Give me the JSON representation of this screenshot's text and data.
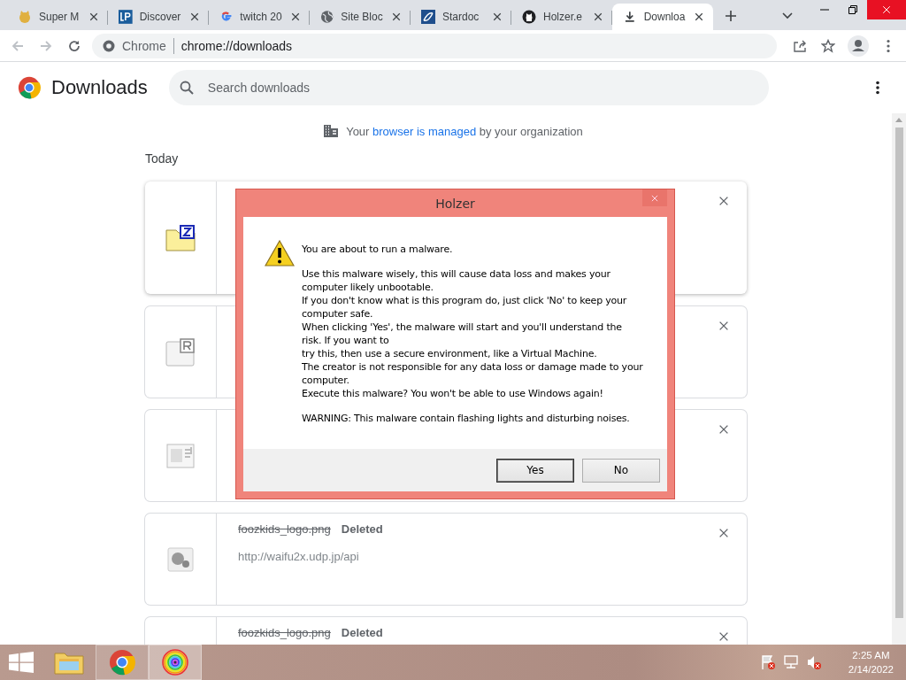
{
  "tabs": [
    {
      "title": "Super M",
      "selected": false
    },
    {
      "title": "Discover",
      "selected": false
    },
    {
      "title": "twitch 20",
      "selected": false
    },
    {
      "title": "Site Bloc",
      "selected": false
    },
    {
      "title": "Stardoc",
      "selected": false
    },
    {
      "title": "Holzer.e",
      "selected": false
    },
    {
      "title": "Downloa",
      "selected": true
    }
  ],
  "toolbar": {
    "site_label": "Chrome",
    "url": "chrome://downloads"
  },
  "header": {
    "title": "Downloads",
    "search_placeholder": "Search downloads"
  },
  "managed_notice": {
    "before": "Your",
    "link": "browser is managed",
    "after": "by your organization"
  },
  "section_title": "Today",
  "downloads": [
    {
      "kind": "archive"
    },
    {
      "kind": "rar"
    },
    {
      "kind": "document"
    },
    {
      "kind": "image",
      "file_name": "foozkids_logo.png",
      "status": "Deleted",
      "url": "http://waifu2x.udp.jp/api"
    },
    {
      "file_name": "foozkids_logo.png",
      "status": "Deleted"
    }
  ],
  "dialog": {
    "title": "Holzer",
    "paragraphs": [
      [
        "You are about to run a malware."
      ],
      [
        "Use this malware wisely, this will cause data loss and makes your",
        "computer likely unbootable.",
        "If you don't know what is this program do, just click 'No' to keep your",
        "computer safe.",
        "When clicking 'Yes', the malware will start and you'll understand the",
        "risk. If you want to",
        "try this, then use a secure environment, like a Virtual Machine.",
        "The creator is not responsible for any data loss or damage made to your",
        "computer.",
        "Execute this malware? You won't be able to use Windows again!"
      ],
      [
        "WARNING: This malware contain flashing lights and disturbing noises."
      ]
    ],
    "buttons": [
      {
        "label": "Yes",
        "focused": true
      },
      {
        "label": "No",
        "focused": false
      }
    ]
  },
  "taskbar": {
    "apps": [
      {
        "kind": "explorer",
        "open": false,
        "selected": false
      },
      {
        "kind": "chrome",
        "open": true,
        "selected": false
      },
      {
        "kind": "colorwheel",
        "open": true,
        "selected": true
      }
    ],
    "clock": {
      "time": "2:25 AM",
      "date": "2/14/2022"
    }
  }
}
